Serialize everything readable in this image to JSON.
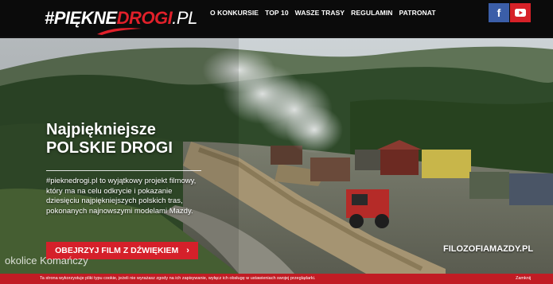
{
  "header": {
    "logo": {
      "hash": "#",
      "word1": "PIĘKNE",
      "word2": "DROGI",
      "tld": ".PL"
    },
    "nav": [
      {
        "label": "O KONKURSIE"
      },
      {
        "label": "TOP 10"
      },
      {
        "label": "WASZE TRASY"
      },
      {
        "label": "REGULAMIN"
      },
      {
        "label": "PATRONAT"
      }
    ],
    "social": {
      "facebook": "f",
      "youtube": "youtube-icon"
    }
  },
  "hero": {
    "headline_line1": "Najpiękniejsze",
    "headline_line2": "POLSKIE DROGI",
    "description": "#pieknedrogi.pl to wyjątkowy projekt filmowy, który ma na celu odkrycie i pokazanie dziesięciu najpiękniejszych polskich tras, pokonanych najnowszymi modelami Mazdy.",
    "cta_label": "OBEJRZYJ FILM Z DŹWIĘKIEM",
    "cta_arrow": "›",
    "caption_left": "okolice Komańczy",
    "caption_right": "FILOZOFIAMAZDY.PL"
  },
  "cookie_bar": {
    "text": "Ta strona wykorzystuje pliki typu cookie, jeżeli nie wyrażasz zgody na ich zapisywanie, wyłącz ich obsługę w ustawieniach swojej przeglądarki.",
    "close_label": "Zamknij"
  },
  "colors": {
    "brand_red": "#d5202a",
    "facebook_blue": "#3b5ea8",
    "youtube_red": "#d62128"
  }
}
